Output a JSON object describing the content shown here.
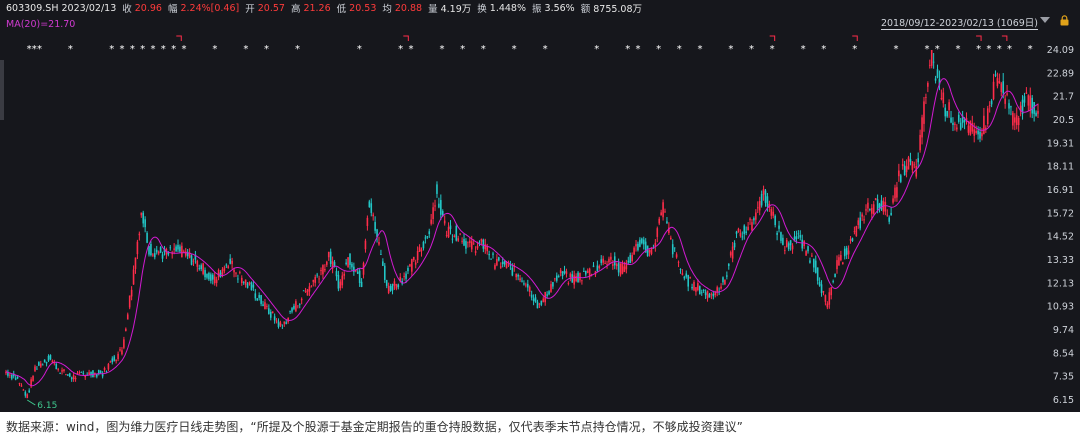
{
  "quote": {
    "code_date": "603309.SH 2023/02/13",
    "close_label": "收",
    "close": "20.96",
    "chg_label": "幅",
    "chg": "2.24%[0.46]",
    "open_label": "开",
    "open": "20.57",
    "high_label": "高",
    "high": "21.26",
    "low_label": "低",
    "low": "20.53",
    "avg_label": "均",
    "avg": "20.88",
    "vol_label": "量",
    "vol": "4.19万",
    "turn_label": "换",
    "turn": "1.448%",
    "amp_label": "振",
    "amp": "3.56%",
    "amt_label": "额",
    "amt": "8755.08万"
  },
  "ma_label": "MA(20)=21.70",
  "range_label": "2018/09/12-2023/02/13 (1069日)",
  "min_marker": "6.15",
  "footer_text": "数据来源：wind，图为维力医疗日线走势图，“所提及个股源于基金定期报告的重仓持股数据，仅代表季末节点持仓情况，不够成投资建议”",
  "colors": {
    "up": "#ff2d4a",
    "down": "#22c7c7",
    "ma": "#d21ad2",
    "bg": "#16171c",
    "text": "#cfd3da"
  },
  "chart_data": {
    "type": "candlestick",
    "x_range": [
      "2018/09/12",
      "2023/02/13"
    ],
    "n_days": 1069,
    "ylim": [
      6.15,
      24.09
    ],
    "y_ticks": [
      "24.09",
      "22.89",
      "21.7",
      "20.5",
      "19.31",
      "18.11",
      "16.91",
      "15.72",
      "14.52",
      "13.33",
      "12.13",
      "10.93",
      "9.74",
      "8.54",
      "7.35",
      "6.15"
    ],
    "ma_period": 20,
    "ma_last": 21.7,
    "last_close": 20.96,
    "low_point": 6.15,
    "price_path": [
      [
        0,
        7.6
      ],
      [
        12,
        7.2
      ],
      [
        22,
        6.3
      ],
      [
        30,
        7.8
      ],
      [
        45,
        8.3
      ],
      [
        55,
        7.7
      ],
      [
        68,
        7.3
      ],
      [
        80,
        7.5
      ],
      [
        100,
        7.5
      ],
      [
        110,
        8.2
      ],
      [
        120,
        8.7
      ],
      [
        130,
        12.0
      ],
      [
        140,
        15.8
      ],
      [
        148,
        13.9
      ],
      [
        165,
        13.6
      ],
      [
        180,
        13.8
      ],
      [
        200,
        13.1
      ],
      [
        215,
        12.2
      ],
      [
        230,
        13.3
      ],
      [
        240,
        12.6
      ],
      [
        255,
        11.8
      ],
      [
        270,
        10.8
      ],
      [
        285,
        9.9
      ],
      [
        300,
        11.0
      ],
      [
        320,
        12.4
      ],
      [
        335,
        13.5
      ],
      [
        345,
        12.0
      ],
      [
        355,
        13.5
      ],
      [
        368,
        12.2
      ],
      [
        375,
        16.4
      ],
      [
        385,
        14.3
      ],
      [
        395,
        11.8
      ],
      [
        410,
        12.4
      ],
      [
        425,
        13.4
      ],
      [
        437,
        14.7
      ],
      [
        445,
        16.8
      ],
      [
        455,
        14.9
      ],
      [
        470,
        14.6
      ],
      [
        480,
        14.0
      ],
      [
        495,
        14.1
      ],
      [
        505,
        13.2
      ],
      [
        520,
        13.0
      ],
      [
        538,
        12.2
      ],
      [
        552,
        10.9
      ],
      [
        565,
        12.1
      ],
      [
        575,
        12.6
      ],
      [
        585,
        12.3
      ],
      [
        600,
        12.6
      ],
      [
        615,
        13.1
      ],
      [
        625,
        13.5
      ],
      [
        635,
        12.8
      ],
      [
        645,
        13.3
      ],
      [
        655,
        14.2
      ],
      [
        668,
        13.7
      ],
      [
        680,
        16.0
      ],
      [
        690,
        13.9
      ],
      [
        702,
        12.4
      ],
      [
        718,
        11.8
      ],
      [
        730,
        11.5
      ],
      [
        745,
        12.4
      ],
      [
        755,
        14.5
      ],
      [
        770,
        15.1
      ],
      [
        785,
        16.8
      ],
      [
        795,
        15.3
      ],
      [
        805,
        14.0
      ],
      [
        820,
        14.4
      ],
      [
        835,
        13.3
      ],
      [
        850,
        11.0
      ],
      [
        860,
        13.0
      ],
      [
        875,
        14.3
      ],
      [
        890,
        15.9
      ],
      [
        905,
        16.3
      ],
      [
        915,
        15.6
      ],
      [
        925,
        17.7
      ],
      [
        935,
        18.3
      ],
      [
        942,
        17.9
      ],
      [
        950,
        21.0
      ],
      [
        958,
        24.1
      ],
      [
        962,
        22.9
      ],
      [
        972,
        21.2
      ],
      [
        982,
        20.5
      ],
      [
        995,
        20.1
      ],
      [
        1005,
        19.7
      ],
      [
        1015,
        20.6
      ],
      [
        1025,
        22.8
      ],
      [
        1035,
        21.5
      ],
      [
        1045,
        20.2
      ],
      [
        1055,
        21.7
      ],
      [
        1069,
        20.96
      ]
    ]
  }
}
